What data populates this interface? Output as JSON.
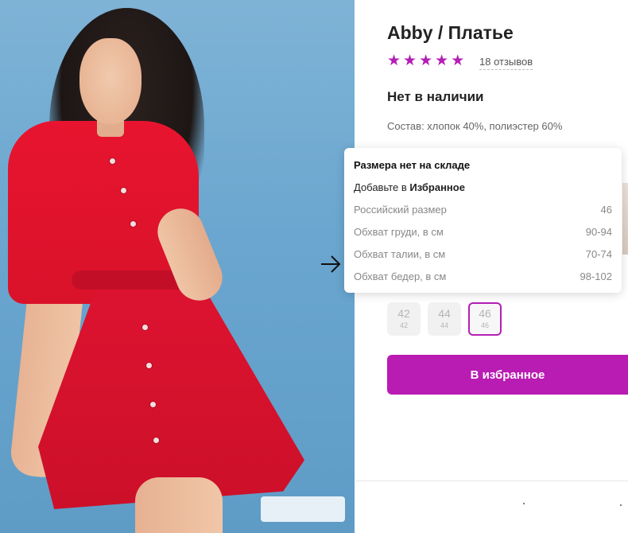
{
  "product": {
    "title": "Abby / Платье",
    "rating_stars": 5,
    "reviews_text": "18 отзывов",
    "stock_status": "Нет в наличии",
    "composition": "Состав: хлопок 40%, полиэстер 60%"
  },
  "tooltip": {
    "title": "Размера нет на складе",
    "add_prefix": "Добавьте в ",
    "add_bold": "Избранное",
    "rows": [
      {
        "label": "Российский размер",
        "value": "46"
      },
      {
        "label": "Обхват груди, в см",
        "value": "90-94"
      },
      {
        "label": "Обхват талии, в см",
        "value": "70-74"
      },
      {
        "label": "Обхват бедер, в см",
        "value": "98-102"
      }
    ]
  },
  "sizes": [
    {
      "main": "42",
      "sub": "42",
      "selected": false
    },
    {
      "main": "44",
      "sub": "44",
      "selected": false
    },
    {
      "main": "46",
      "sub": "46",
      "selected": true
    }
  ],
  "favorite_button": {
    "label": "В избранное"
  },
  "colors": {
    "accent": "#b91cb2",
    "star": "#b31fb5",
    "photo_background": "#6aa6cf",
    "dress": "#dd1330"
  },
  "icons": {
    "star": "star-icon",
    "arrow": "arrow-right-icon"
  }
}
